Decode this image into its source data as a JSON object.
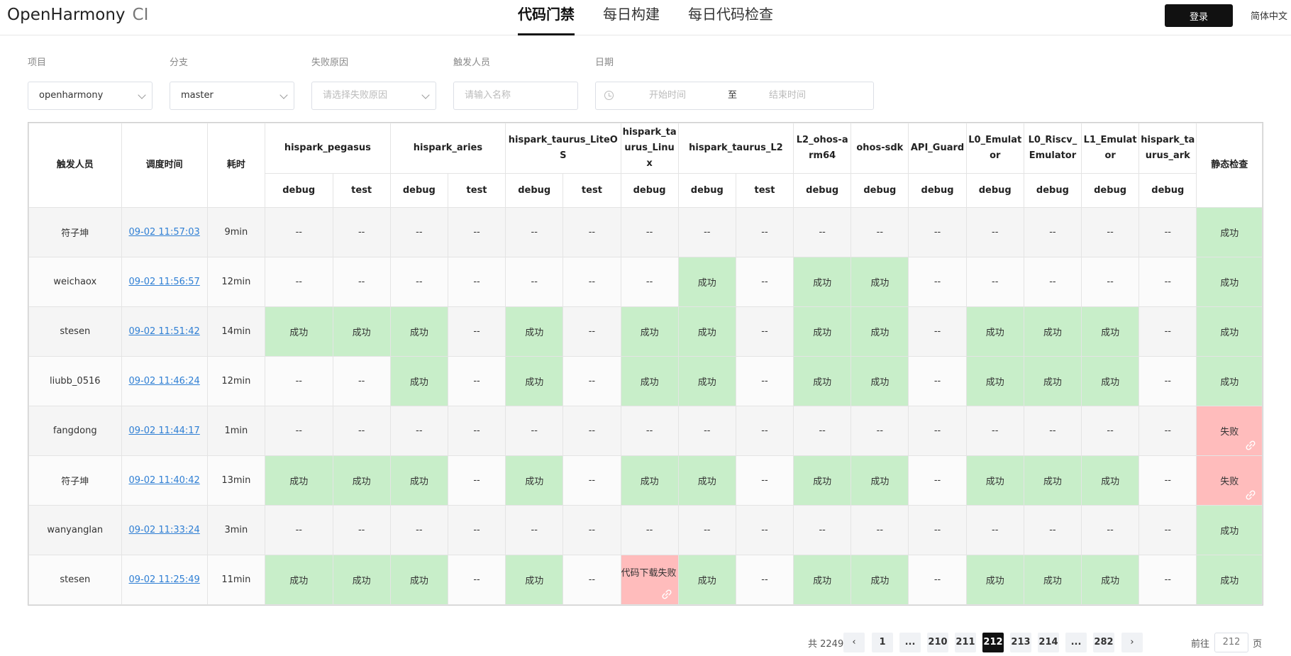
{
  "header": {
    "brand": "OpenHarmony",
    "brand_suffix": "CI",
    "tabs": [
      "代码门禁",
      "每日构建",
      "每日代码检查"
    ],
    "active_tab": 0,
    "login_label": "登录",
    "language": "简体中文"
  },
  "filters": {
    "project_label": "项目",
    "project_value": "openharmony",
    "branch_label": "分支",
    "branch_value": "master",
    "reason_label": "失败原因",
    "reason_placeholder": "请选择失败原因",
    "trigger_label": "触发人员",
    "trigger_placeholder": "请输入名称",
    "date_label": "日期",
    "date_start_placeholder": "开始时间",
    "date_separator": "至",
    "date_end_placeholder": "结束时间"
  },
  "table": {
    "fixed_headers": {
      "trigger": "触发人员",
      "time": "调度时间",
      "duration": "耗时",
      "static": "静态检查"
    },
    "groups": [
      {
        "name": "hispark_pegasus",
        "subs": [
          "debug",
          "test"
        ]
      },
      {
        "name": "hispark_aries",
        "subs": [
          "debug",
          "test"
        ]
      },
      {
        "name": "hispark_taurus_LiteOS",
        "subs": [
          "debug",
          "test"
        ]
      },
      {
        "name": "hispark_taurus_Linux",
        "subs": [
          "debug"
        ]
      },
      {
        "name": "hispark_taurus_L2",
        "subs": [
          "debug",
          "test"
        ]
      },
      {
        "name": "L2_ohos-arm64",
        "subs": [
          "debug"
        ]
      },
      {
        "name": "ohos-sdk",
        "subs": [
          "debug"
        ]
      },
      {
        "name": "API_Guard",
        "subs": [
          "debug"
        ]
      },
      {
        "name": "L0_Emulator",
        "subs": [
          "debug"
        ]
      },
      {
        "name": "L0_Riscv_Emulator",
        "subs": [
          "debug"
        ]
      },
      {
        "name": "L1_Emulator",
        "subs": [
          "debug"
        ]
      },
      {
        "name": "hispark_taurus_ark",
        "subs": [
          "debug"
        ]
      }
    ],
    "status_labels": {
      "ok": "成功",
      "fail": "失败",
      "none": "--",
      "download_fail": "代码下载失败"
    },
    "rows": [
      {
        "trigger": "符子坤",
        "time": "09-02 11:57:03",
        "duration": "9min",
        "cells": [
          "none",
          "none",
          "none",
          "none",
          "none",
          "none",
          "none",
          "none",
          "none",
          "none",
          "none",
          "none",
          "none",
          "none",
          "none",
          "none"
        ],
        "static": "ok"
      },
      {
        "trigger": "weichaox",
        "time": "09-02 11:56:57",
        "duration": "12min",
        "cells": [
          "none",
          "none",
          "none",
          "none",
          "none",
          "none",
          "none",
          "ok",
          "none",
          "ok",
          "ok",
          "none",
          "none",
          "none",
          "none",
          "none"
        ],
        "static": "ok"
      },
      {
        "trigger": "stesen",
        "time": "09-02 11:51:42",
        "duration": "14min",
        "cells": [
          "ok",
          "ok",
          "ok",
          "none",
          "ok",
          "none",
          "ok",
          "ok",
          "none",
          "ok",
          "ok",
          "none",
          "ok",
          "ok",
          "ok",
          "none"
        ],
        "static": "ok"
      },
      {
        "trigger": "liubb_0516",
        "time": "09-02 11:46:24",
        "duration": "12min",
        "cells": [
          "none",
          "none",
          "ok",
          "none",
          "ok",
          "none",
          "ok",
          "ok",
          "none",
          "ok",
          "ok",
          "none",
          "ok",
          "ok",
          "ok",
          "none"
        ],
        "static": "ok"
      },
      {
        "trigger": "fangdong",
        "time": "09-02 11:44:17",
        "duration": "1min",
        "cells": [
          "none",
          "none",
          "none",
          "none",
          "none",
          "none",
          "none",
          "none",
          "none",
          "none",
          "none",
          "none",
          "none",
          "none",
          "none",
          "none"
        ],
        "static": "fail"
      },
      {
        "trigger": "符子坤",
        "time": "09-02 11:40:42",
        "duration": "13min",
        "cells": [
          "ok",
          "ok",
          "ok",
          "none",
          "ok",
          "none",
          "ok",
          "ok",
          "none",
          "ok",
          "ok",
          "none",
          "ok",
          "ok",
          "ok",
          "none"
        ],
        "static": "fail"
      },
      {
        "trigger": "wanyanglan",
        "time": "09-02 11:33:24",
        "duration": "3min",
        "cells": [
          "none",
          "none",
          "none",
          "none",
          "none",
          "none",
          "none",
          "none",
          "none",
          "none",
          "none",
          "none",
          "none",
          "none",
          "none",
          "none"
        ],
        "static": "ok"
      },
      {
        "trigger": "stesen",
        "time": "09-02 11:25:49",
        "duration": "11min",
        "cells": [
          "ok",
          "ok",
          "ok",
          "none",
          "ok",
          "none",
          "download_fail",
          "ok",
          "none",
          "ok",
          "ok",
          "none",
          "ok",
          "ok",
          "ok",
          "none"
        ],
        "static": "ok"
      }
    ]
  },
  "pagination": {
    "total": "共 2249 条",
    "pages": [
      "1",
      "...",
      "210",
      "211",
      "212",
      "213",
      "214",
      "...",
      "282"
    ],
    "current": "212",
    "goto_label": "前往",
    "goto_value": "212",
    "page_suffix": "页"
  },
  "colors": {
    "success_bg": "#c8eec9",
    "success_text": "#4caf50",
    "fail_bg": "#ffbcbc",
    "fail_text": "#f04141",
    "link": "#2f7fd4"
  }
}
